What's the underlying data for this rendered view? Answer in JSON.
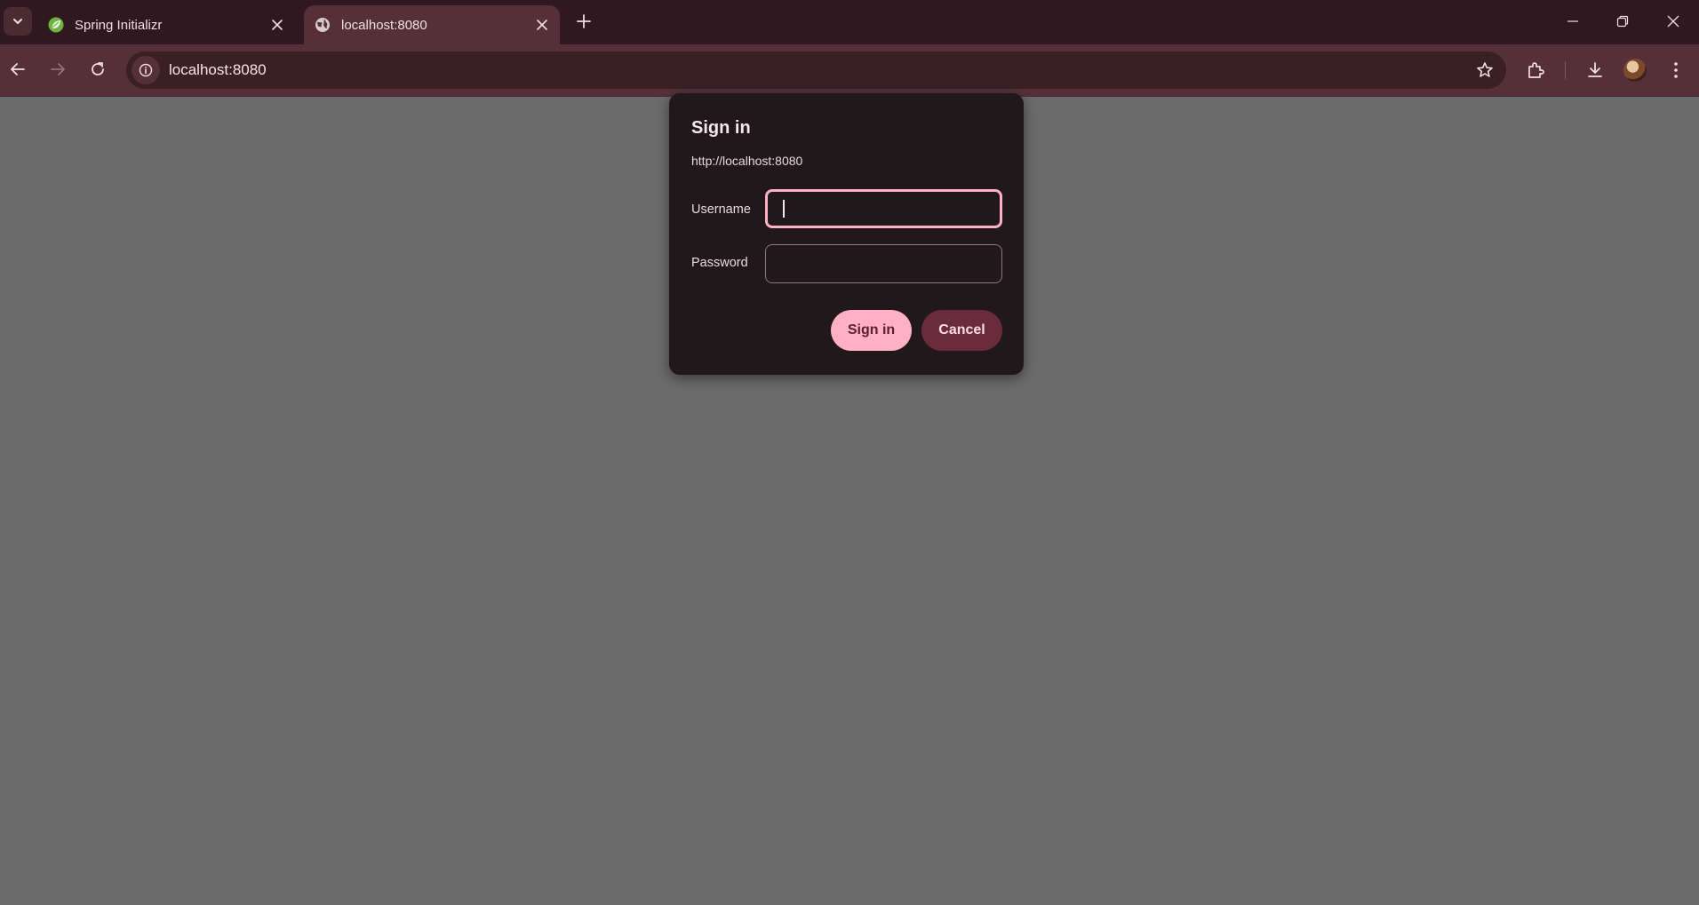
{
  "browser": {
    "tabs": [
      {
        "title": "Spring Initializr",
        "icon": "spring-leaf-icon",
        "active": false
      },
      {
        "title": "localhost:8080",
        "icon": "globe-icon",
        "active": true
      }
    ],
    "url": "localhost:8080",
    "colors": {
      "tabstrip": "#301820",
      "toolbar": "#55303a",
      "omnibox": "#3a1f27",
      "page": "#6b6b6b"
    }
  },
  "dialog": {
    "title": "Sign in",
    "origin": "http://localhost:8080",
    "username_label": "Username",
    "username_value": "",
    "password_label": "Password",
    "password_value": "",
    "sign_in_label": "Sign in",
    "cancel_label": "Cancel",
    "colors": {
      "background": "#21181b",
      "primary": "#ffb0c3",
      "secondary": "#6a2b3d"
    }
  }
}
